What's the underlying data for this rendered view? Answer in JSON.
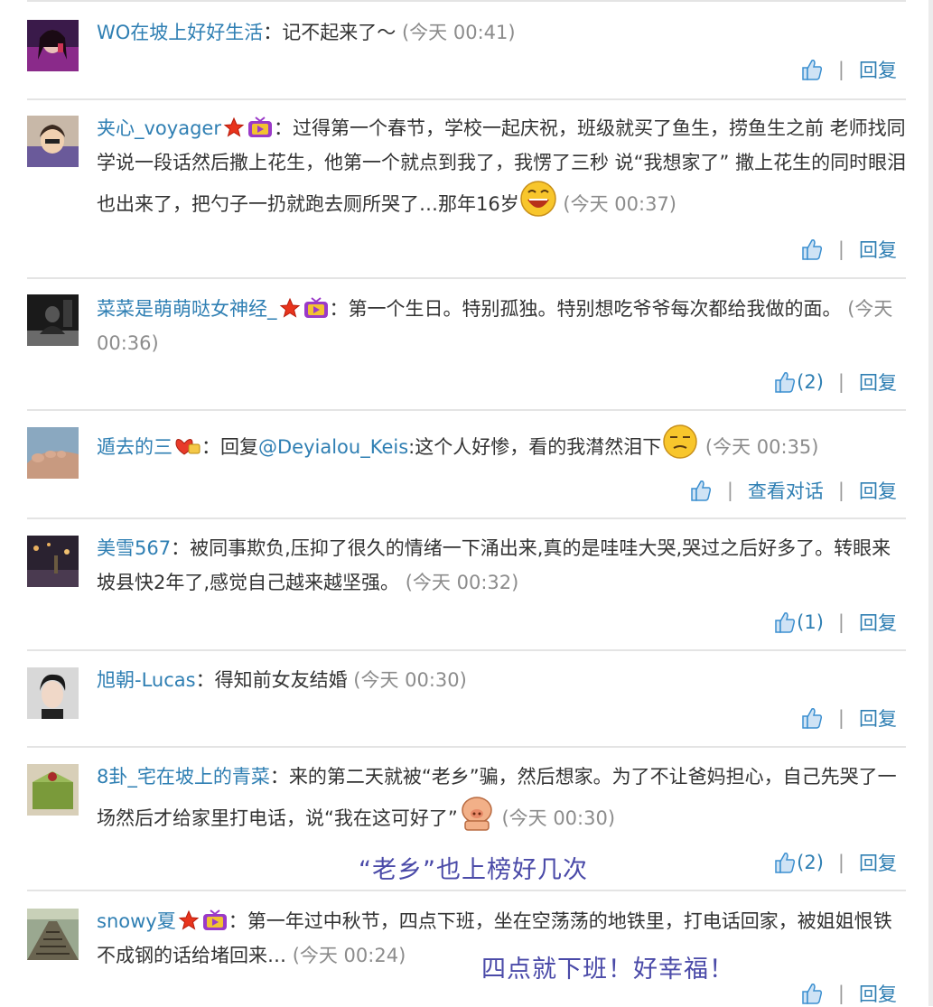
{
  "colors": {
    "link": "#2f7fb3",
    "timestamp": "#8c8c8c",
    "separator": "#9a9a9a",
    "overlay": "#4a4aa8",
    "rule": "#e4e4e4"
  },
  "icons": {
    "like": "thumbs-up-icon",
    "member": "star-icon",
    "video_vip": "tv-icon",
    "heart_badge": "heart-badge-icon"
  },
  "colon": "：",
  "separator": "|",
  "reply_label": "回复",
  "comments": [
    {
      "user": "WO在坡上好好生活",
      "text": "记不起来了～",
      "time": "(今天 00:41)",
      "likes": ""
    },
    {
      "user": "夹心_voyager",
      "text": "过得第一个春节，学校一起庆祝，班级就买了鱼生，捞鱼生之前 老师找同学说一段话然后撒上花生，他第一个就点到我了，我愣了三秒 说“我想家了” 撒上花生的同时眼泪也出来了，把勺子一扔就跑去厕所哭了…那年16岁",
      "time": "(今天 00:37)",
      "likes": ""
    },
    {
      "user": "菜菜是萌萌哒女神经_",
      "text": "第一个生日。特别孤独。特别想吃爷爷每次都给我做的面。",
      "time": "(今天 00:36)",
      "likes": "(2)"
    },
    {
      "user": "遁去的三",
      "reply_prefix": "回复",
      "mention": "@Deyialou_Keis",
      "text": ":这个人好惨，看的我潸然泪下",
      "time": "(今天 00:35)",
      "likes": "",
      "view_conversation": "查看对话"
    },
    {
      "user": "美雪567",
      "text": "被同事欺负,压抑了很久的情绪一下涌出来,真的是哇哇大哭,哭过之后好多了。转眼来坡县快2年了,感觉自己越来越坚强。",
      "time": "(今天 00:32)",
      "likes": "(1)"
    },
    {
      "user": "旭朝-Lucas",
      "text": "得知前女友结婚",
      "time": "(今天 00:30)",
      "likes": ""
    },
    {
      "user": "8卦_宅在坡上的青菜",
      "text": "来的第二天就被“老乡”骗，然后想家。为了不让爸妈担心，自己先哭了一场然后才给家里打电话，说“我在这可好了”",
      "time": "(今天 00:30)",
      "likes": "(2)"
    },
    {
      "user": "snowy夏",
      "text": "第一年过中秋节，四点下班，坐在空荡荡的地铁里，打电话回家，被姐姐恨铁不成钢的话给堵回来…",
      "time": "(今天 00:24)",
      "likes": ""
    }
  ],
  "overlays": {
    "laoxiang": "“老乡”也上榜好几次",
    "sidian": "四点就下班！好幸福！"
  }
}
